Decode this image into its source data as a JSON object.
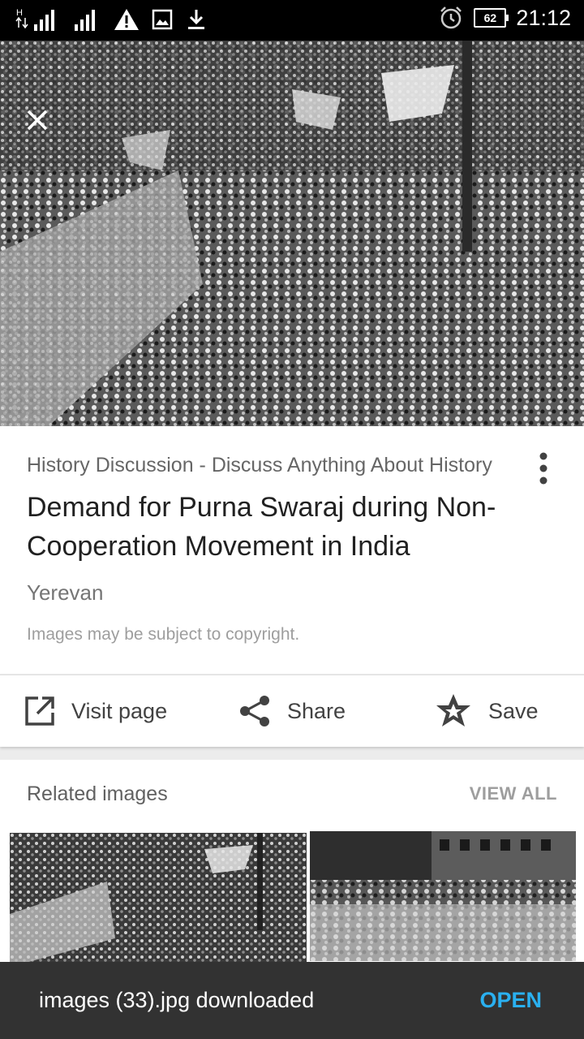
{
  "status_bar": {
    "network_type": "H",
    "battery_level": "62",
    "time": "21:12",
    "icons": [
      "signal-icon",
      "signal-icon",
      "warning-icon",
      "image-icon",
      "download-icon",
      "alarm-icon",
      "battery-icon"
    ]
  },
  "viewer": {
    "close_icon": "close-icon"
  },
  "result": {
    "source": "History Discussion - Discuss Anything About History",
    "title": "Demand for Purna Swaraj during Non-Cooperation Movement in India",
    "location": "Yerevan",
    "copyright_notice": "Images may be subject to copyright."
  },
  "actions": {
    "visit_label": "Visit page",
    "share_label": "Share",
    "save_label": "Save"
  },
  "related": {
    "title": "Related images",
    "view_all_label": "VIEW ALL"
  },
  "snackbar": {
    "message": "images (33).jpg downloaded",
    "action_label": "OPEN"
  },
  "colors": {
    "snackbar_bg": "#323232",
    "snackbar_action": "#2ab0f0",
    "status_bar_bg": "#000000"
  }
}
